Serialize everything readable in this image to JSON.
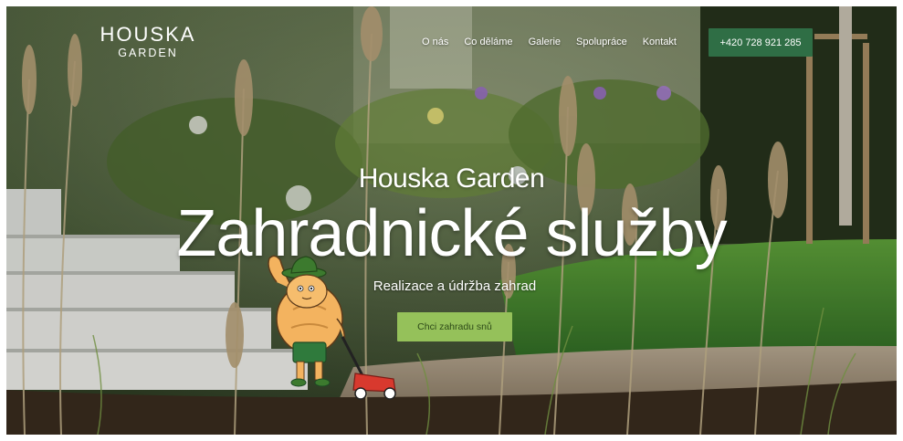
{
  "brand": {
    "logo_main": "HOUSKA",
    "logo_sub": "GARDEN",
    "accent": "#2f6e45",
    "cta_color": "#95c15a"
  },
  "nav": {
    "items": [
      {
        "label": "O nás"
      },
      {
        "label": "Co děláme"
      },
      {
        "label": "Galerie"
      },
      {
        "label": "Spolupráce"
      },
      {
        "label": "Kontakt"
      }
    ],
    "phone_label": "+420 728 921 285"
  },
  "hero": {
    "subtitle": "Houska Garden",
    "title": "Zahradnické služby",
    "tagline": "Realizace a údržba zahrad",
    "cta_label": "Chci zahradu snů"
  }
}
